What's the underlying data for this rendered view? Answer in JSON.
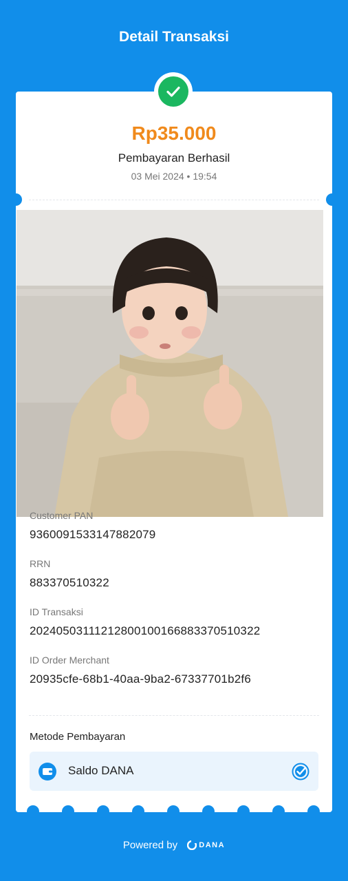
{
  "header": {
    "title": "Detail Transaksi"
  },
  "summary": {
    "amount": "Rp35.000",
    "status": "Pembayaran Berhasil",
    "datetime": "03 Mei 2024 • 19:54"
  },
  "details": [
    {
      "label": "Customer PAN",
      "value": "9360091533147882079"
    },
    {
      "label": "RRN",
      "value": "883370510322"
    },
    {
      "label": "ID Transaksi",
      "value": "20240503111212800100166883370510322"
    },
    {
      "label": "ID Order Merchant",
      "value": "20935cfe-68b1-40aa-9ba2-67337701b2f6"
    }
  ],
  "payment_method": {
    "title": "Metode Pembayaran",
    "name": "Saldo DANA"
  },
  "footer": {
    "powered_by": "Powered by",
    "brand": "DANA"
  },
  "colors": {
    "background": "#118EEA",
    "amount": "#F08A1C",
    "success": "#1BB760"
  }
}
